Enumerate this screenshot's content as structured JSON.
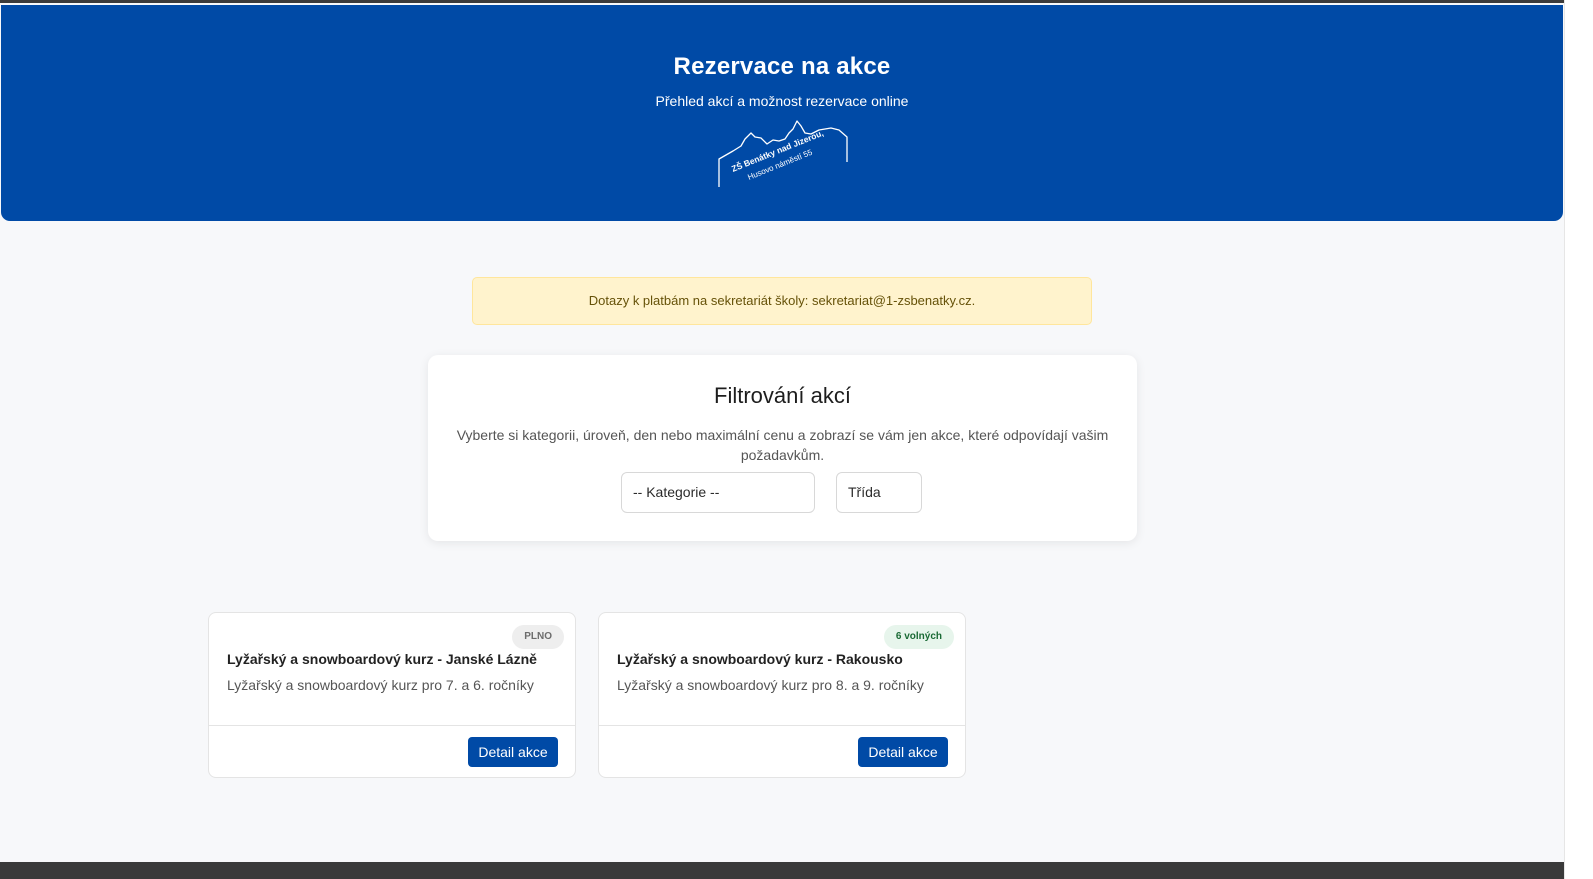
{
  "header": {
    "title": "Rezervace na akce",
    "subtitle": "Přehled akcí a možnost rezervace online",
    "logo": {
      "line1": "ZŠ Benátky nad Jizerou,",
      "line2": "Husovo náměstí 55"
    }
  },
  "notice": {
    "text": "Dotazy k platbám na sekretariát školy: sekretariat@1-zsbenatky.cz."
  },
  "filter": {
    "title": "Filtrování akcí",
    "description": "Vyberte si kategorii, úroveň, den nebo maximální cenu a zobrazí se vám jen akce, které odpovídají vašim požadavkům.",
    "category_select": "-- Kategorie --",
    "class_select": "Třída"
  },
  "events": [
    {
      "badge": "PLNO",
      "title": "Lyžařský a snowboardový kurz - Janské Lázně",
      "description": "Lyžařský a snowboardový kurz pro 7. a 6. ročníky",
      "button": "Detail akce"
    },
    {
      "badge": "6 volných",
      "title": "Lyžařský a snowboardový kurz - Rakousko",
      "description": "Lyžařský a snowboardový kurz pro 8. a 9. ročníky",
      "button": "Detail akce"
    }
  ],
  "colors": {
    "brand": "#004aa6",
    "notice_bg": "#fff3cd",
    "badge_free": "#e7f5ec",
    "badge_full": "#eeeeee"
  }
}
